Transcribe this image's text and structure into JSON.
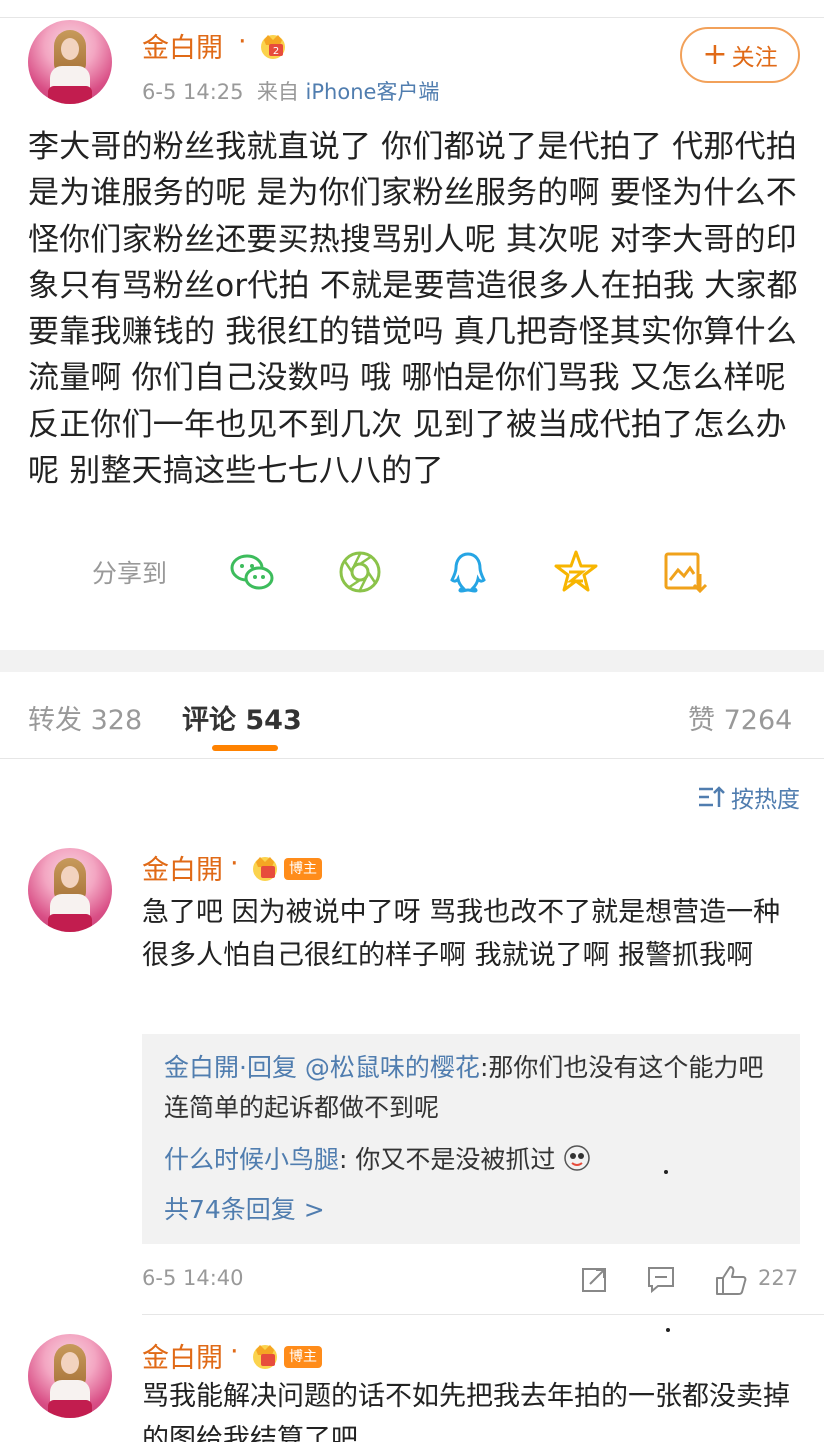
{
  "post": {
    "author": "金白開",
    "dot": "·",
    "timestamp": "6-5 14:25",
    "source_prefix": "来自",
    "source": "iPhone客户端",
    "follow_label": "关注",
    "text": "李大哥的粉丝我就直说了 你们都说了是代拍了 代那代拍是为谁服务的呢 是为你们家粉丝服务的啊 要怪为什么不怪你们家粉丝还要买热搜骂别人呢 其次呢 对李大哥的印象只有骂粉丝or代拍 不就是要营造很多人在拍我 大家都要靠我赚钱的 我很红的错觉吗 真几把奇怪其实你算什么流量啊 你们自己没数吗 哦 哪怕是你们骂我 又怎么样呢 反正你们一年也见不到几次 见到了被当成代拍了怎么办呢 别整天搞这些七七八八的了"
  },
  "share": {
    "label": "分享到",
    "icons": [
      "wechat-icon",
      "moments-icon",
      "qq-icon",
      "qzone-icon",
      "save-image-icon"
    ]
  },
  "tabs": {
    "repost": "转发 328",
    "comment": "评论 543",
    "like": "赞 7264"
  },
  "sort_label": "按热度",
  "comments": [
    {
      "author": "金白開",
      "dot": "·",
      "badge": "博主",
      "text": "急了吧 因为被说中了呀 骂我也改不了就是想营造一种很多人怕自己很红的样子啊 我就说了啊 报警抓我啊",
      "replies": {
        "r1_author": "金白開",
        "r1_mid": "·回复",
        "r1_mention": "@松鼠味的樱花",
        "r1_text": ":那你们也没有这个能力吧连简单的起诉都做不到呢",
        "r2_author": "什么时候小鸟腿",
        "r2_text": ": 你又不是没被抓过",
        "more": "共74条回复 >"
      },
      "time": "6-5 14:40",
      "likes": "227"
    },
    {
      "author": "金白開",
      "dot": "·",
      "badge": "博主",
      "text": "骂我能解决问题的话不如先把我去年拍的一张都没卖掉的图给我结算了吧"
    }
  ],
  "colors": {
    "name": "#e06a17",
    "link": "#507daf",
    "accent": "#ff8200",
    "badge": "#ff8c1a"
  }
}
